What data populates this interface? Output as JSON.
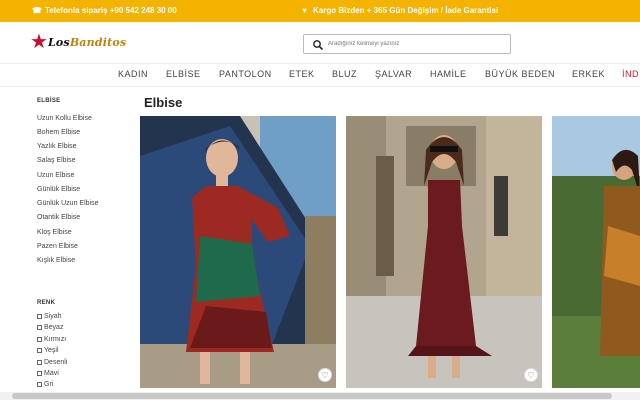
{
  "topbar": {
    "phone": "Telefonla sipariş +90 542 248 30 00",
    "promo": "Kargo Bizden + 365 Gün Değişim / İade Garantisi",
    "phone_icon": "phone-icon",
    "promo_icon": "heart-icon"
  },
  "header": {
    "logo_part1": "Los",
    "logo_part2": "Banditos",
    "search_placeholder": "Aradığınız kelimeyi yazınız"
  },
  "nav": {
    "items": [
      "KADIN",
      "ELBİSE",
      "PANTOLON",
      "ETEK",
      "BLUZ",
      "ŞALVAR",
      "HAMİLE",
      "BÜYÜK BEDEN",
      "ERKEK",
      "İND"
    ]
  },
  "sidebar": {
    "category_title": "ELBİSE",
    "categories": [
      "Uzun Kollu Elbise",
      "Bohem Elbise",
      "Yazlık Elbise",
      "Salaş Elbise",
      "Uzun Elbise",
      "Günlük Elbise",
      "Günlük Uzun Elbise",
      "Otantik Elbise",
      "Kloş Elbise",
      "Pazen Elbise",
      "Kışlık Elbise"
    ],
    "color_title": "RENK",
    "colors": [
      "Siyah",
      "Beyaz",
      "Kırmızı",
      "Yeşil",
      "Desenli",
      "Mavi",
      "Gri"
    ]
  },
  "main": {
    "title": "Elbise"
  },
  "colors": {
    "topbar": "#f5b301",
    "accent": "#e0141e",
    "logo_star": "#c8102e"
  }
}
